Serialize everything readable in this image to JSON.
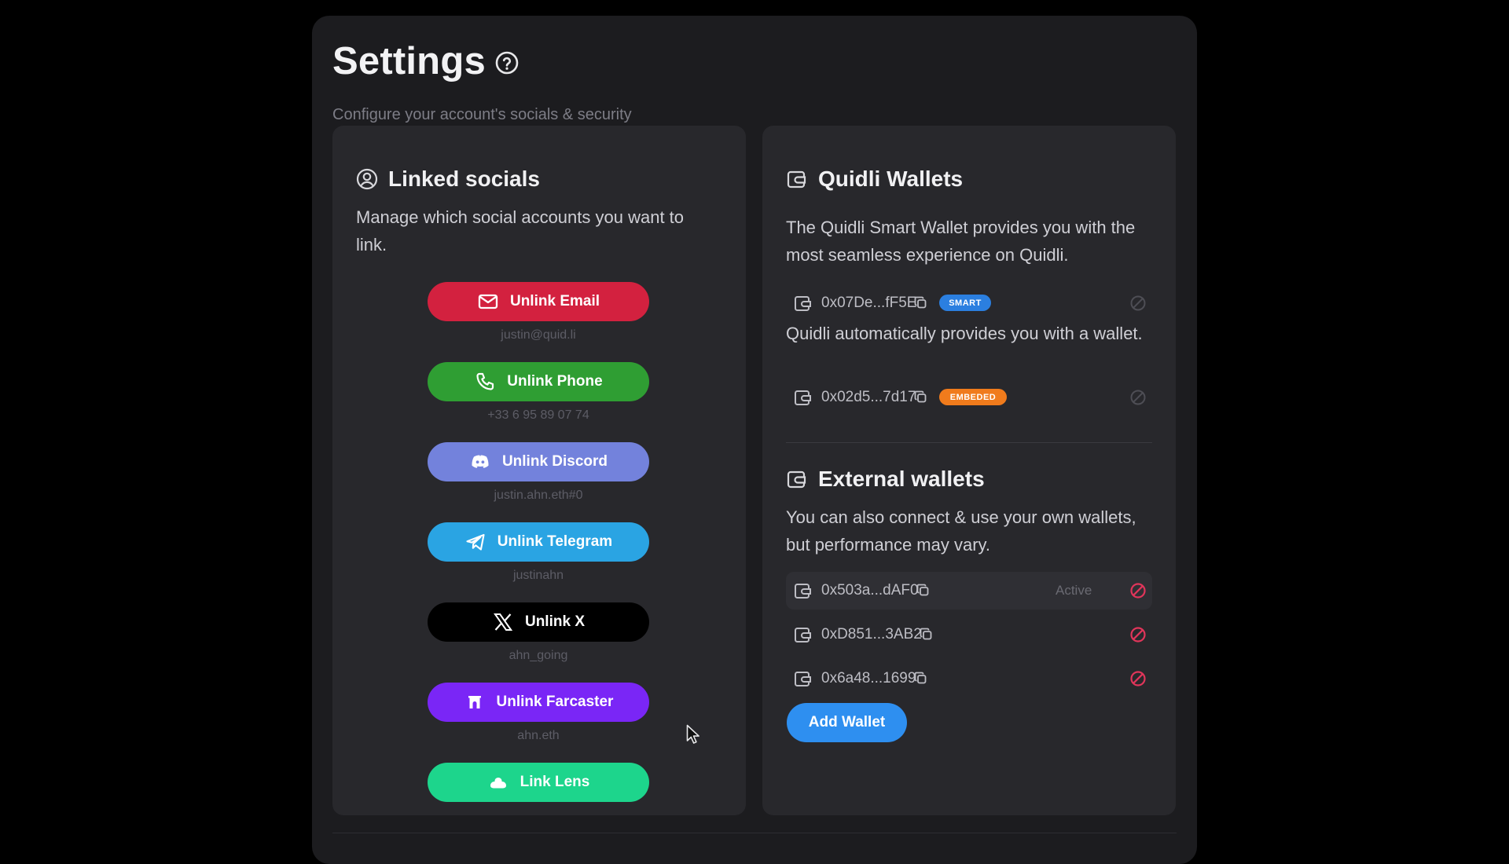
{
  "header": {
    "title": "Settings",
    "subtitle": "Configure your account's socials & security"
  },
  "linked_socials": {
    "title": "Linked socials",
    "description": "Manage which social accounts you want to link.",
    "items": [
      {
        "label": "Unlink Email",
        "sub": "justin@quid.li",
        "color": "#d3213f",
        "icon": "mail-icon"
      },
      {
        "label": "Unlink Phone",
        "sub": "+33 6 95 89 07 74",
        "color": "#2f9e33",
        "icon": "phone-icon"
      },
      {
        "label": "Unlink Discord",
        "sub": "justin.ahn.eth#0",
        "color": "#7382dc",
        "icon": "discord-icon"
      },
      {
        "label": "Unlink Telegram",
        "sub": "justinahn",
        "color": "#2aa4e3",
        "icon": "telegram-icon"
      },
      {
        "label": "Unlink X",
        "sub": "ahn_going",
        "color": "#000000",
        "icon": "x-logo-icon"
      },
      {
        "label": "Unlink Farcaster",
        "sub": "ahn.eth",
        "color": "#7a26f6",
        "icon": "farcaster-icon"
      },
      {
        "label": "Link Lens",
        "sub": "",
        "color": "#1dd58c",
        "icon": "lens-icon"
      }
    ]
  },
  "quidli_wallets": {
    "title": "Quidli Wallets",
    "description": "The Quidli Smart Wallet provides you with the most seamless experience on Quidli.",
    "smart_wallet": {
      "address": "0x07De...fF5E",
      "badge": "SMART",
      "badge_color": "#2b7fe0"
    },
    "auto_note": "Quidli automatically provides you with a wallet.",
    "embedded_wallet": {
      "address": "0x02d5...7d17",
      "badge": "EMBEDED",
      "badge_color": "#f07b1c"
    }
  },
  "external_wallets": {
    "title": "External wallets",
    "description": "You can also connect & use your own wallets, but performance may vary.",
    "wallets": [
      {
        "address": "0x503a...dAF0",
        "status": "Active"
      },
      {
        "address": "0xD851...3AB2",
        "status": ""
      },
      {
        "address": "0x6a48...1699",
        "status": ""
      }
    ],
    "add_label": "Add Wallet"
  },
  "colors": {
    "background": "#000000",
    "panel": "#1c1c1f",
    "card": "#28282c",
    "remove_red": "#e0355a",
    "accent_blue": "#2e8ff0"
  }
}
